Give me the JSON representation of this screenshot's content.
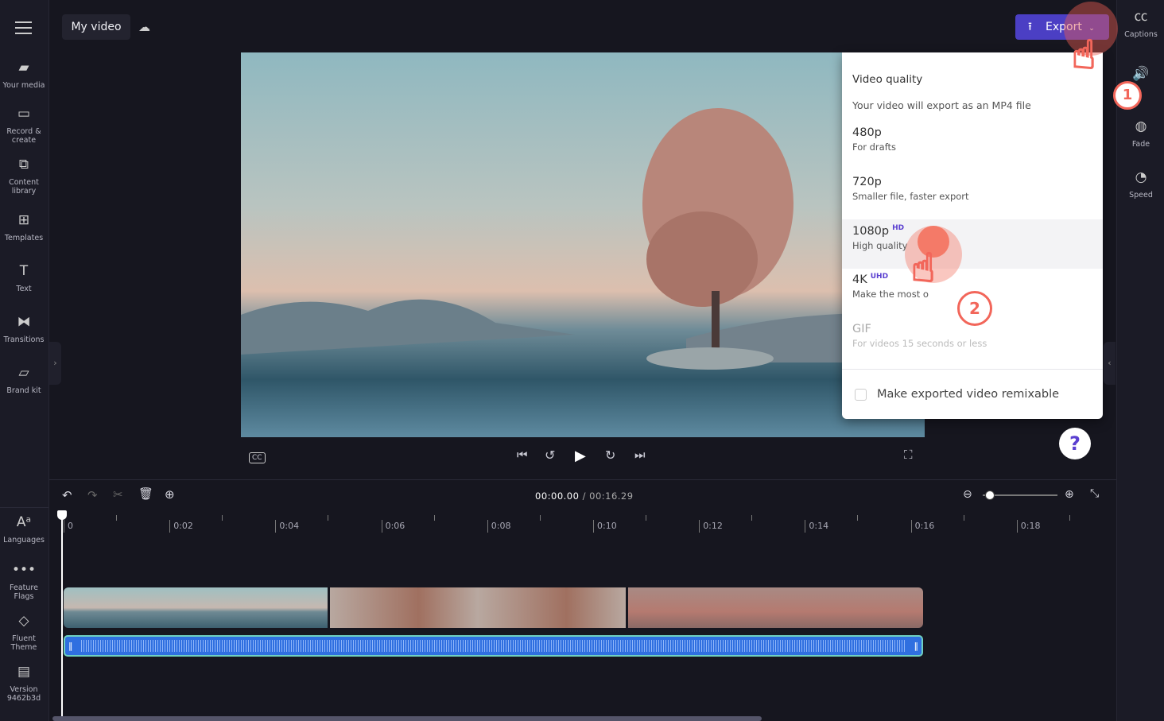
{
  "header": {
    "project_title": "My video",
    "export_label": "Export"
  },
  "left_nav": [
    {
      "label": "Your media",
      "icon": "folder-icon"
    },
    {
      "label": "Record & create",
      "icon": "camera-icon"
    },
    {
      "label": "Content library",
      "icon": "library-icon"
    },
    {
      "label": "Templates",
      "icon": "templates-icon"
    },
    {
      "label": "Text",
      "icon": "text-icon"
    },
    {
      "label": "Transitions",
      "icon": "transitions-icon"
    },
    {
      "label": "Brand kit",
      "icon": "brand-kit-icon"
    }
  ],
  "left_nav_bottom": [
    {
      "label": "Languages",
      "icon": "languages-icon"
    },
    {
      "label": "Feature Flags",
      "icon": "more-icon"
    },
    {
      "label": "Fluent Theme",
      "icon": "paint-bucket-icon"
    },
    {
      "label": "Version 9462b3d",
      "icon": "archive-icon"
    }
  ],
  "right_nav": [
    {
      "label": "Captions",
      "icon": "captions-icon"
    },
    {
      "label": "",
      "icon": "audio-icon"
    },
    {
      "label": "Fade",
      "icon": "fade-icon"
    },
    {
      "label": "Speed",
      "icon": "speed-icon"
    }
  ],
  "export_menu": {
    "heading": "Video quality",
    "subheading": "Your video will export as an MP4 file",
    "options": [
      {
        "quality": "480p",
        "badge": "",
        "desc": "For drafts"
      },
      {
        "quality": "720p",
        "badge": "",
        "desc": "Smaller file, faster export"
      },
      {
        "quality": "1080p",
        "badge": "HD",
        "desc": "High quality"
      },
      {
        "quality": "4K",
        "badge": "UHD",
        "desc": "Make the most o"
      },
      {
        "quality": "GIF",
        "badge": "",
        "desc": "For videos 15 seconds or less"
      }
    ],
    "remix_label": "Make exported video remixable",
    "remix_checked": false
  },
  "timeline": {
    "current_time": "00:00.00",
    "total_time": "/ 00:16.29",
    "ticks": [
      "0",
      "0:02",
      "0:04",
      "0:06",
      "0:08",
      "0:10",
      "0:12",
      "0:14",
      "0:16",
      "0:18"
    ],
    "zoom_level": 0.1
  },
  "annotations": {
    "step1": "1",
    "step2": "2"
  },
  "colors": {
    "accent": "#4b3fc4",
    "audio_track": "#2f6fe0",
    "pointer": "#f2665a"
  }
}
